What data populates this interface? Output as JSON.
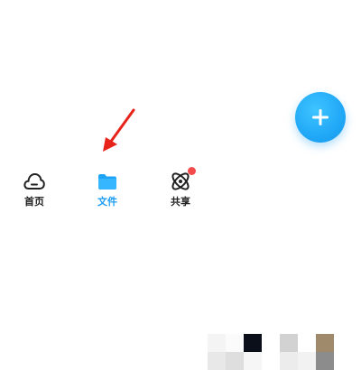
{
  "tabbar": {
    "tabs": [
      {
        "label": "首页",
        "icon": "cloud-icon",
        "active": false
      },
      {
        "label": "文件",
        "icon": "folder-icon",
        "active": true
      },
      {
        "label": "共享",
        "icon": "atom-icon",
        "active": false,
        "badge": true
      }
    ]
  },
  "fab": {
    "icon": "plus-icon"
  },
  "colors": {
    "accent": "#1a9cf2",
    "badge": "#f44c4c",
    "arrow": "#e8231a"
  }
}
